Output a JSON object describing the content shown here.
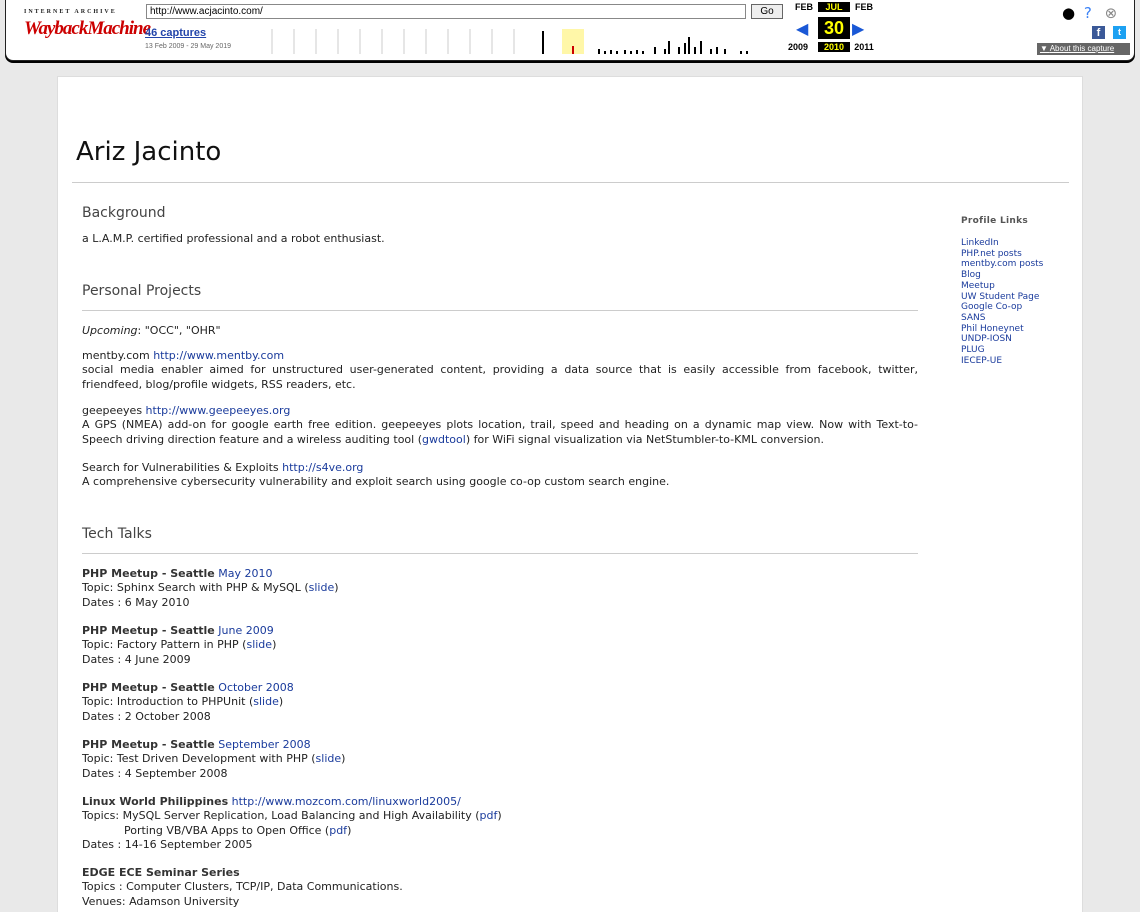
{
  "wayback": {
    "logo_top": "INTERNET ARCHIVE",
    "logo_main": "WaybackMachine",
    "url": "http://www.acjacinto.com/",
    "go": "Go",
    "captures": "46 captures",
    "range": "13 Feb 2009 - 29 May 2019",
    "months": [
      "FEB",
      "JUL",
      "FEB"
    ],
    "day": "30",
    "years": [
      "2009",
      "2010",
      "2011"
    ],
    "about": "About this capture",
    "icons": [
      "user-icon",
      "help-icon",
      "close-icon",
      "facebook-icon",
      "twitter-icon"
    ]
  },
  "page": {
    "title": "Ariz Jacinto",
    "background": {
      "heading": "Background",
      "text": "a L.A.M.P. certified professional and a robot enthusiast."
    },
    "projects": {
      "heading": "Personal Projects",
      "upcoming_label": "Upcoming",
      "upcoming_value": ": \"OCC\", \"OHR\"",
      "items": [
        {
          "name": "mentby.com",
          "url": "http://www.mentby.com",
          "desc": "social media enabler aimed for unstructured user-generated content, providing a data source that is easily accessible from facebook, twitter, friendfeed, blog/profile widgets, RSS readers, etc."
        },
        {
          "name": "geepeeyes",
          "url": "http://www.geepeeyes.org",
          "desc_a": "A GPS (NMEA) add-on for google earth free edition. geepeeyes plots location, trail, speed and heading on a dynamic map view. Now with Text-to-Speech driving direction feature and a wireless auditing tool (",
          "desc_link": "gwdtool",
          "desc_b": ") for WiFi signal visualization via NetStumbler-to-KML conversion."
        },
        {
          "name": "Search for Vulnerabilities & Exploits",
          "url": "http://s4ve.org",
          "desc": "A comprehensive cybersecurity vulnerability and exploit search using google co-op custom search engine."
        }
      ]
    },
    "talks": {
      "heading": "Tech Talks",
      "items": [
        {
          "event": "PHP Meetup - Seattle",
          "when": "May 2010",
          "topic": "Topic: Sphinx Search with PHP & MySQL (",
          "slide": "slide",
          "dates": "Dates : 6 May 2010"
        },
        {
          "event": "PHP Meetup - Seattle",
          "when": "June 2009",
          "topic": "Topic: Factory Pattern in PHP (",
          "slide": "slide",
          "dates": "Dates : 4 June 2009"
        },
        {
          "event": "PHP Meetup - Seattle",
          "when": "October 2008",
          "topic": "Topic: Introduction to PHPUnit (",
          "slide": "slide",
          "dates": "Dates : 2 October 2008"
        },
        {
          "event": "PHP Meetup - Seattle",
          "when": "September 2008",
          "topic": "Topic: Test Driven Development with PHP (",
          "slide": "slide",
          "dates": "Dates : 4 September 2008"
        }
      ],
      "linux": {
        "event": "Linux World Philippines",
        "url": "http://www.mozcom.com/linuxworld2005/",
        "topic1": "Topics: MySQL Server Replication, Load Balancing and High Availability (",
        "topic2": "Porting VB/VBA Apps to Open Office (",
        "pdf": "pdf",
        "dates": "Dates : 14-16 September 2005"
      },
      "edge": {
        "event": "EDGE ECE Seminar Series",
        "topics": "Topics : Computer Clusters, TCP/IP, Data Communications.",
        "venues": "Venues: Adamson University"
      }
    },
    "sidebar": {
      "heading": "Profile Links",
      "links": [
        "LinkedIn",
        "PHP.net posts",
        "mentby.com posts",
        "Blog",
        "Meetup",
        "UW Student Page",
        "Google Co-op",
        "SANS",
        "Phil Honeynet",
        "UNDP-IOSN",
        "PLUG",
        "IECEP-UE"
      ]
    }
  }
}
